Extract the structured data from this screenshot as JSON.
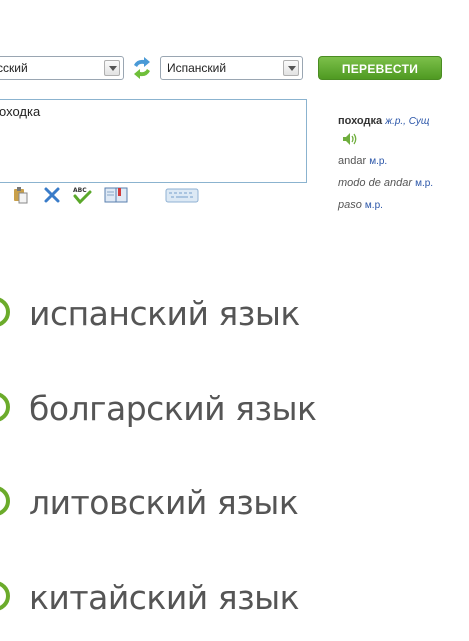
{
  "translator": {
    "source_language": "сский",
    "target_language": "Испанский",
    "translate_button": "ПЕРЕВЕСТИ",
    "source_text": "оходка"
  },
  "dictionary": {
    "headword": "походка",
    "headword_grammar": "ж.р., Сущ",
    "translations": [
      {
        "word": "andar",
        "grammar": "м.р."
      },
      {
        "word": "modo de andar",
        "grammar": "м.р."
      },
      {
        "word": "paso",
        "grammar": "м.р."
      }
    ]
  },
  "toolbar": {
    "icons": [
      "paste-icon",
      "clear-icon",
      "spellcheck-icon",
      "dictionary-icon",
      "keyboard-icon"
    ]
  },
  "quiz": {
    "options": [
      {
        "label": "испанский язык"
      },
      {
        "label": "болгарский язык"
      },
      {
        "label": "литовский язык"
      },
      {
        "label": "китайский язык"
      }
    ],
    "accent_color": "#6bab2b"
  }
}
